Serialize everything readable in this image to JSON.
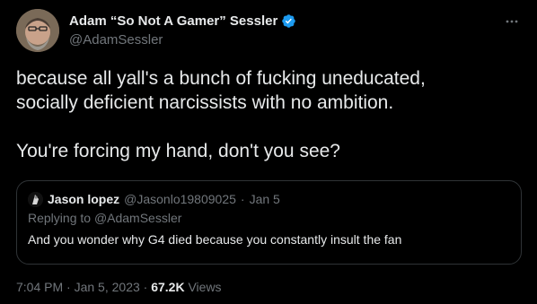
{
  "author": {
    "display_name": "Adam “So Not A Gamer” Sessler",
    "handle": "@AdamSessler",
    "verified": true,
    "avatar_icon": "bearded-man-avatar"
  },
  "more_icon": "ellipsis-icon",
  "tweet": {
    "text": "because all yall's a bunch of fucking uneducated,\nsocially deficient narcissists with no ambition.\n\nYou're forcing my hand, don't you see?"
  },
  "quoted_tweet": {
    "display_name": "Jason lopez",
    "handle": "@Jasonlo19809025",
    "separator": "·",
    "date": "Jan 5",
    "replying_prefix": "Replying to ",
    "replying_to": "@AdamSessler",
    "text": "And you wonder why G4 died because you constantly insult the fan"
  },
  "meta": {
    "time": "7:04 PM",
    "separator": "·",
    "date": "Jan 5, 2023",
    "views_count": "67.2K",
    "views_label": "Views"
  },
  "colors": {
    "background": "#000000",
    "text_primary": "#e7e9ea",
    "text_secondary": "#71767b",
    "border": "#2f3336",
    "verified_blue": "#1d9bf0"
  }
}
